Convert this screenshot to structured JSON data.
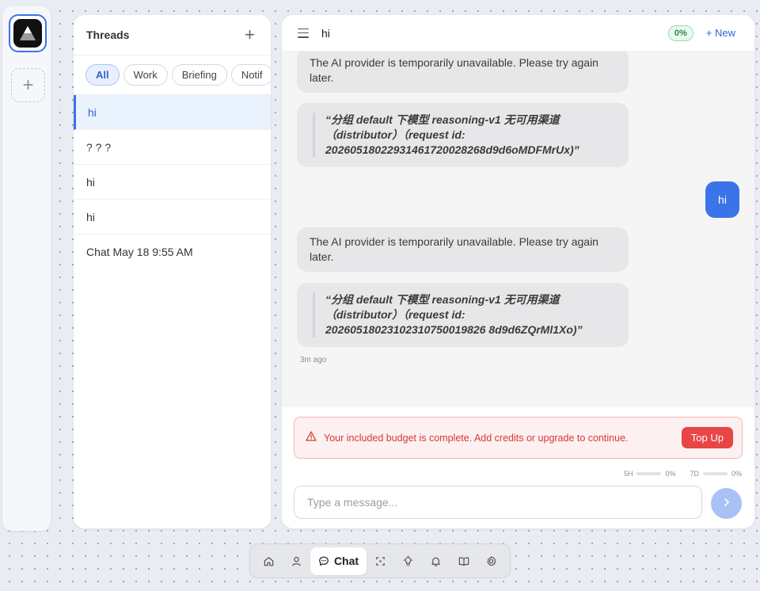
{
  "rail": {
    "add_label": "+"
  },
  "threads": {
    "title": "Threads",
    "add_label": "+",
    "filters": [
      {
        "label": "All",
        "active": true
      },
      {
        "label": "Work",
        "active": false
      },
      {
        "label": "Briefing",
        "active": false
      },
      {
        "label": "Notif",
        "active": false
      }
    ],
    "items": [
      {
        "label": "hi",
        "active": true
      },
      {
        "label": "? ? ?",
        "active": false
      },
      {
        "label": "hi",
        "active": false
      },
      {
        "label": "hi",
        "active": false
      },
      {
        "label": "Chat May 18 9:55 AM",
        "active": false
      }
    ]
  },
  "chat": {
    "title": "hi",
    "usage_badge": "0%",
    "new_label": "+ New",
    "messages": [
      {
        "role": "assistant",
        "text": "The AI provider is temporarily unavailable. Please try again later."
      },
      {
        "role": "assistant",
        "quote": "“分组 default 下模型 reasoning-v1 无可用渠道（distributor）（request id: 20260518022931461720028268d9d6oMDFMrUx)”"
      },
      {
        "role": "user",
        "text": "hi"
      },
      {
        "role": "assistant",
        "text": "The AI provider is temporarily unavailable. Please try again later."
      },
      {
        "role": "assistant",
        "quote": "“分组 default 下模型 reasoning-v1 无可用渠道（distributor）（request id: 20260518023102310750019826 8d9d6ZQrMl1Xo)”"
      }
    ],
    "timestamp": "3m ago",
    "alert": {
      "text": "Your included budget is complete. Add credits or upgrade to continue.",
      "button": "Top Up"
    },
    "usage": {
      "five_hour_label": "5H",
      "five_hour_value": "0%",
      "seven_day_label": "7D",
      "seven_day_value": "0%"
    },
    "composer_placeholder": "Type a message..."
  },
  "dock": {
    "active_label": "Chat",
    "items": [
      "home-icon",
      "person-icon",
      "chat-icon",
      "focus-icon",
      "lightbulb-icon",
      "bell-icon",
      "book-icon",
      "gear-icon"
    ]
  },
  "colors": {
    "accent": "#3b73e8",
    "alert_red": "#e84545",
    "success_green": "#2a8a49"
  }
}
